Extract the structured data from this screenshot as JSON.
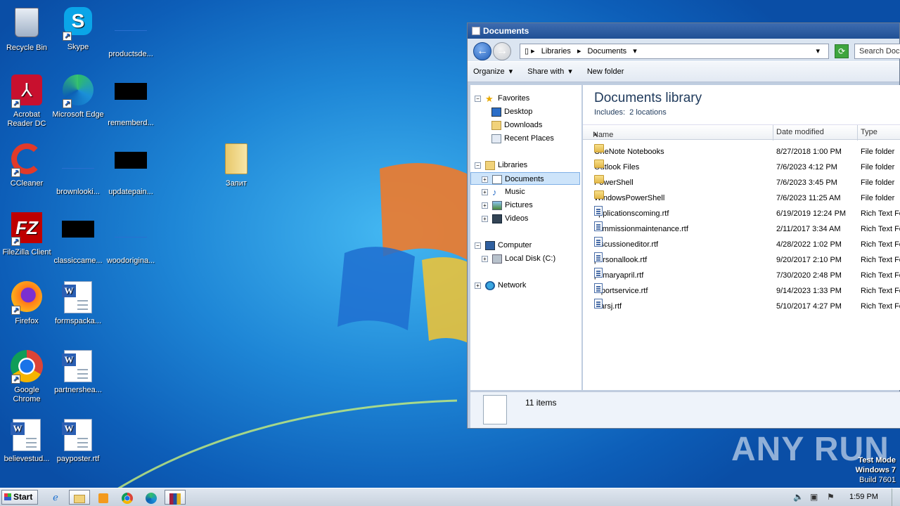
{
  "desktop": {
    "icons": [
      {
        "label": "Recycle Bin",
        "icon": "recycle-bin-icon"
      },
      {
        "label": "Skype",
        "icon": "skype-icon"
      },
      {
        "label": "productsde...",
        "icon": "blank-file-icon"
      },
      {
        "label": "Acrobat Reader DC",
        "icon": "acrobat-icon"
      },
      {
        "label": "Microsoft Edge",
        "icon": "edge-icon"
      },
      {
        "label": "rememberd...",
        "icon": "black-file-icon"
      },
      {
        "label": "CCleaner",
        "icon": "ccleaner-icon"
      },
      {
        "label": "brownlooki...",
        "icon": "blank-file-icon"
      },
      {
        "label": "updatepain...",
        "icon": "black-file-icon"
      },
      {
        "label": "Запит",
        "icon": "folder-icon"
      },
      {
        "label": "FileZilla Client",
        "icon": "filezilla-icon"
      },
      {
        "label": "classiccame...",
        "icon": "black-file-icon"
      },
      {
        "label": "woodorigina...",
        "icon": "blank-file-icon"
      },
      {
        "label": "Firefox",
        "icon": "firefox-icon"
      },
      {
        "label": "formspacka...",
        "icon": "word-doc-icon"
      },
      {
        "label": "Google Chrome",
        "icon": "chrome-icon"
      },
      {
        "label": "partnershea...",
        "icon": "word-doc-icon"
      },
      {
        "label": "believestud...",
        "icon": "word-doc-icon"
      },
      {
        "label": "payposter.rtf",
        "icon": "word-doc-icon"
      }
    ]
  },
  "explorer": {
    "title": "Documents",
    "breadcrumb": [
      "Libraries",
      "Documents"
    ],
    "search_placeholder": "Search Documents",
    "toolbar": {
      "organize": "Organize",
      "share_with": "Share with",
      "new_folder": "New folder"
    },
    "nav": {
      "favorites": "Favorites",
      "desktop": "Desktop",
      "downloads": "Downloads",
      "recent_places": "Recent Places",
      "libraries": "Libraries",
      "documents": "Documents",
      "music": "Music",
      "pictures": "Pictures",
      "videos": "Videos",
      "computer": "Computer",
      "local_disk": "Local Disk (C:)",
      "network": "Network"
    },
    "library_title": "Documents library",
    "includes_label": "Includes:",
    "includes_value": "2 locations",
    "columns": {
      "name": "Name",
      "date": "Date modified",
      "type": "Type"
    },
    "files": [
      {
        "name": "OneNote Notebooks",
        "date": "8/27/2018 1:00 PM",
        "type": "File folder",
        "kind": "folder"
      },
      {
        "name": "Outlook Files",
        "date": "7/6/2023 4:12 PM",
        "type": "File folder",
        "kind": "folder"
      },
      {
        "name": "PowerShell",
        "date": "7/6/2023 3:45 PM",
        "type": "File folder",
        "kind": "folder"
      },
      {
        "name": "WindowsPowerShell",
        "date": "7/6/2023 11:25 AM",
        "type": "File folder",
        "kind": "folder"
      },
      {
        "name": "applicationscoming.rtf",
        "date": "6/19/2019 12:24 PM",
        "type": "Rich Text Fo",
        "kind": "rtf"
      },
      {
        "name": "commissionmaintenance.rtf",
        "date": "2/11/2017 3:34 AM",
        "type": "Rich Text Fo",
        "kind": "rtf"
      },
      {
        "name": "discussioneditor.rtf",
        "date": "4/28/2022 1:02 PM",
        "type": "Rich Text Fo",
        "kind": "rtf"
      },
      {
        "name": "personallook.rtf",
        "date": "9/20/2017 2:10 PM",
        "type": "Rich Text Fo",
        "kind": "rtf"
      },
      {
        "name": "primaryapril.rtf",
        "date": "7/30/2020 2:48 PM",
        "type": "Rich Text Fo",
        "kind": "rtf"
      },
      {
        "name": "reportservice.rtf",
        "date": "9/14/2023 1:33 PM",
        "type": "Rich Text Fo",
        "kind": "rtf"
      },
      {
        "name": "starsj.rtf",
        "date": "5/10/2017 4:27 PM",
        "type": "Rich Text Fo",
        "kind": "rtf"
      }
    ],
    "status_count": "11 items"
  },
  "watermark": {
    "anyrun": "ANY RUN",
    "line1": "Test Mode",
    "line2": "Windows 7",
    "line3": "Build 7601"
  },
  "taskbar": {
    "start": "Start",
    "clock": "1:59 PM"
  }
}
